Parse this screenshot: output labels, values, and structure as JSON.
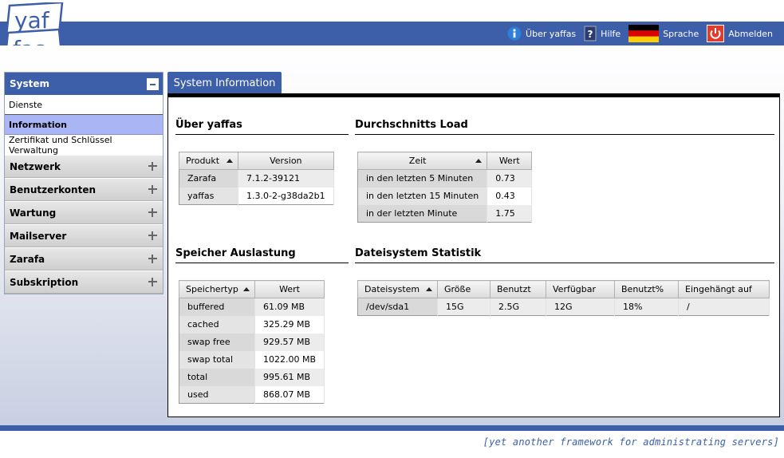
{
  "logo": {
    "line1": "yaf",
    "line2": "fas"
  },
  "top_nav": {
    "about_label": "Über yaffas",
    "help_label": "Hilfe",
    "language_label": "Sprache",
    "logout_label": "Abmelden"
  },
  "sidebar": {
    "active_group": "System",
    "sub_items": [
      "Dienste",
      "Information",
      "Zertifikat und Schlüssel Verwaltung"
    ],
    "groups": [
      "Netzwerk",
      "Benutzerkonten",
      "Wartung",
      "Mailserver",
      "Zarafa",
      "Subskription"
    ]
  },
  "main": {
    "tab_label": "System Information",
    "about": {
      "title": "Über yaffas",
      "headers": [
        "Produkt",
        "Version"
      ],
      "rows": [
        [
          "Zarafa",
          "7.1.2-39121"
        ],
        [
          "yaffas",
          "1.3.0-2-g38da2b1"
        ]
      ]
    },
    "load": {
      "title": "Durchschnitts Load",
      "headers": [
        "Zeit",
        "Wert"
      ],
      "rows": [
        [
          "in den letzten 5 Minuten",
          "0.73"
        ],
        [
          "in den letzten 15 Minuten",
          "0.43"
        ],
        [
          "in der letzten Minute",
          "1.75"
        ]
      ]
    },
    "memory": {
      "title": "Speicher Auslastung",
      "headers": [
        "Speichertyp",
        "Wert"
      ],
      "rows": [
        [
          "buffered",
          "61.09 MB"
        ],
        [
          "cached",
          "325.29 MB"
        ],
        [
          "swap free",
          "929.57 MB"
        ],
        [
          "swap total",
          "1022.00 MB"
        ],
        [
          "total",
          "995.61 MB"
        ],
        [
          "used",
          "868.07 MB"
        ]
      ]
    },
    "filesystem": {
      "title": "Dateisystem Statistik",
      "headers": [
        "Dateisystem",
        "Größe",
        "Benutzt",
        "Verfügbar",
        "Benutzt%",
        "Eingehängt auf"
      ],
      "rows": [
        [
          "/dev/sda1",
          "15G",
          "2.5G",
          "12G",
          "18%",
          "/"
        ]
      ]
    }
  },
  "footer": {
    "tagline": "[yet another framework for administrating servers]"
  },
  "colors": {
    "brand_blue": "#3d5ea9",
    "active_item": "#a9b5f5"
  }
}
